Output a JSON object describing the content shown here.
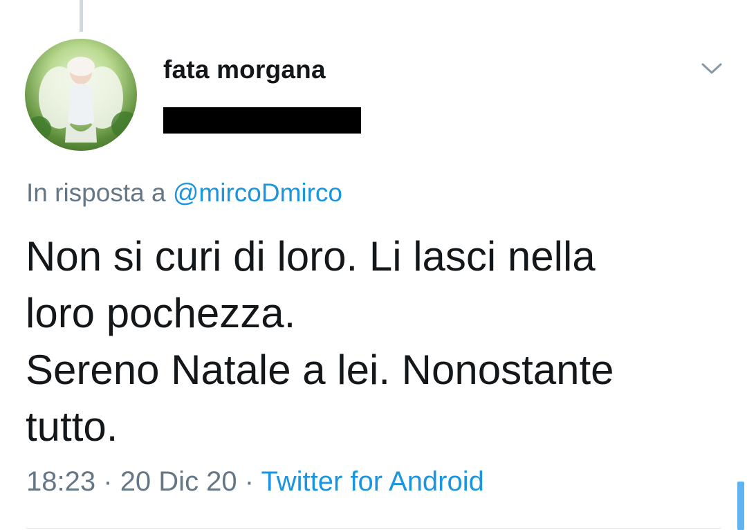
{
  "tweet": {
    "author": {
      "display_name": "fata morgana",
      "avatar_icon": "fairy-avatar-icon"
    },
    "reply_prefix": "In risposta a",
    "reply_to": "@mircoDmirco",
    "text_lines": [
      "Non si curi di loro. Li lasci nella",
      "loro pochezza.",
      "Sereno Natale a lei. Nonostante",
      "tutto."
    ],
    "time": "18:23",
    "separator": "·",
    "date": "20 Dic 20",
    "source": "Twitter for Android"
  },
  "colors": {
    "text": "#14171a",
    "secondary": "#657786",
    "link": "#1b95e0",
    "redaction": "#000000"
  }
}
